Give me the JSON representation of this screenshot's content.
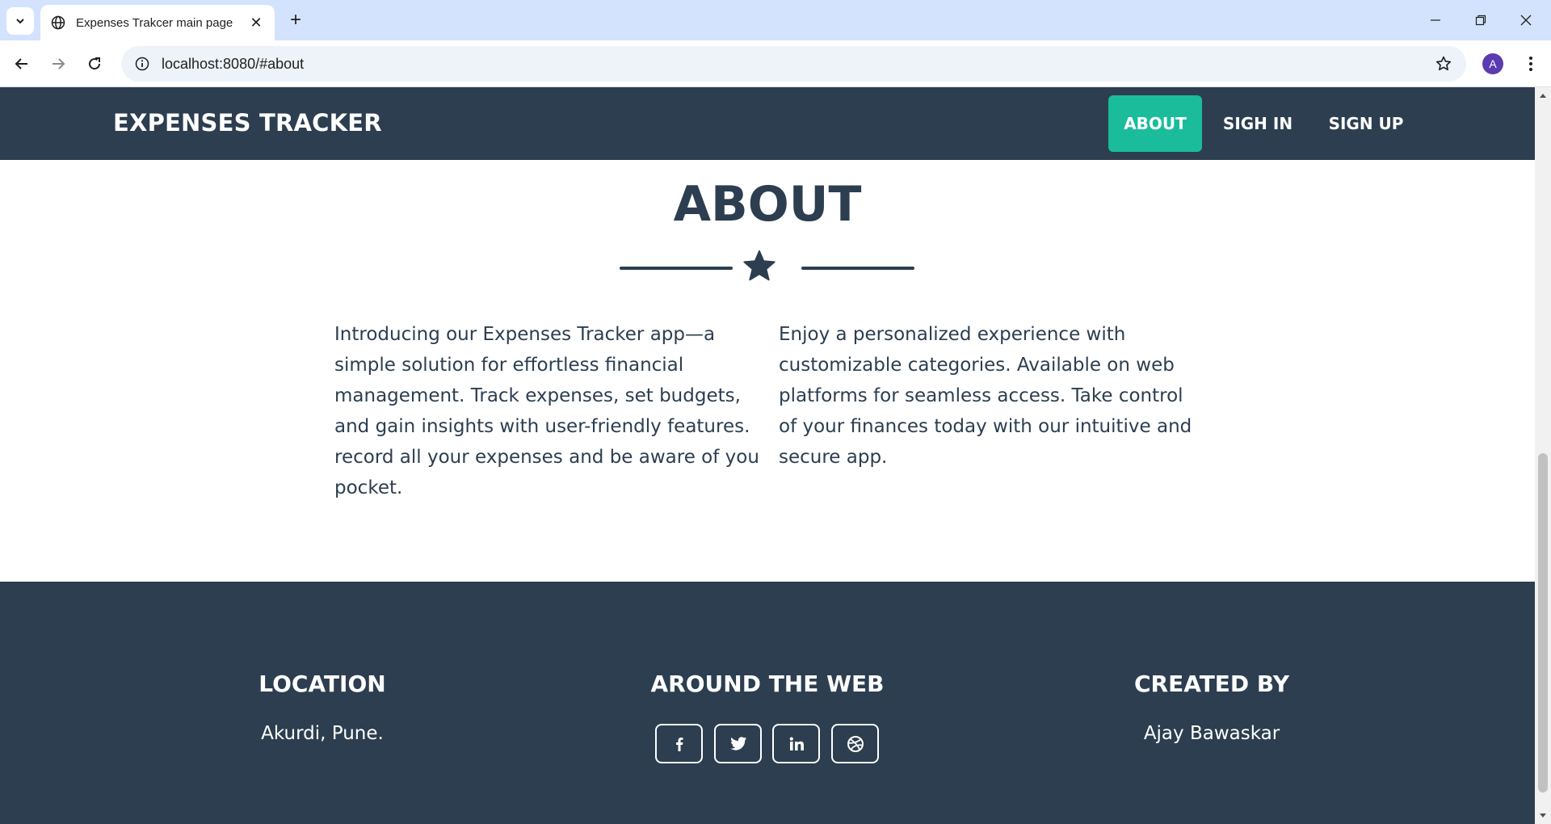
{
  "browser": {
    "tab_title": "Expenses Trakcer main page",
    "url": "localhost:8080/#about",
    "profile_initial": "A"
  },
  "site": {
    "brand": "EXPENSES TRACKER",
    "nav": [
      {
        "label": "ABOUT",
        "active": true
      },
      {
        "label": "SIGH IN",
        "active": false
      },
      {
        "label": "SIGN UP",
        "active": false
      }
    ]
  },
  "about": {
    "title": "ABOUT",
    "paragraph_left": "Introducing our Expenses Tracker app—a simple solution for effortless financial management. Track expenses, set budgets, and gain insights with user-friendly features. record all your expenses and be aware of you pocket.",
    "paragraph_right": "Enjoy a personalized experience with customizable categories. Available on web platforms for seamless access. Take control of your finances today with our intuitive and secure app."
  },
  "footer": {
    "location": {
      "heading": "LOCATION",
      "text": "Akurdi, Pune."
    },
    "web": {
      "heading": "AROUND THE WEB",
      "icons": [
        "facebook-icon",
        "twitter-icon",
        "linkedin-icon",
        "dribbble-icon"
      ]
    },
    "created": {
      "heading": "CREATED BY",
      "text": "Ajay Bawaskar"
    }
  },
  "colors": {
    "primary": "#2c3e50",
    "accent": "#1abc9c",
    "tabbar": "#d3e3fd"
  }
}
